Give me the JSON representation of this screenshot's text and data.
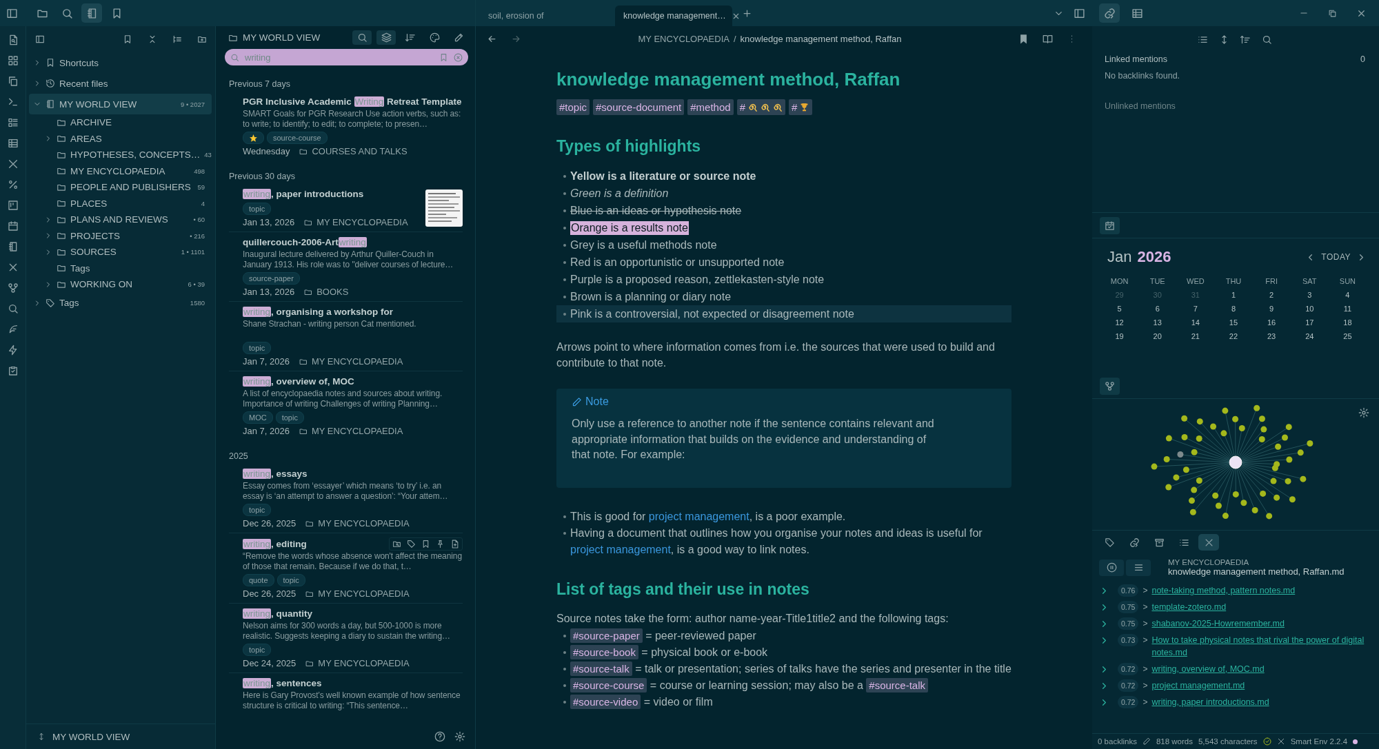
{
  "window": {
    "left_tabs": [
      {
        "selected": false
      },
      {
        "selected": false
      },
      {
        "selected": true
      },
      {
        "selected": false
      }
    ],
    "tabs": [
      {
        "label": "soil, erosion of",
        "selected": false
      },
      {
        "label": "knowledge management…",
        "selected": true
      }
    ],
    "right_tabs": [
      {
        "selected": true
      },
      {
        "selected": false
      }
    ]
  },
  "file_explorer": {
    "items": [
      {
        "label": "Shortcuts",
        "kind": "shortcuts",
        "expanded": false,
        "selected": false
      },
      {
        "label": "Recent files",
        "kind": "recent",
        "expanded": false,
        "selected": false
      },
      {
        "label": "MY WORLD VIEW",
        "kind": "vault",
        "expanded": true,
        "selected": true,
        "count": "9 • 2027",
        "children": [
          {
            "label": "ARCHIVE",
            "selected": false
          },
          {
            "label": "AREAS",
            "expanded": false,
            "selected": false
          },
          {
            "label": "HYPOTHESES, CONCEPTS…",
            "selected": false,
            "count": "43"
          },
          {
            "label": "MY ENCYCLOPAEDIA",
            "selected": false,
            "count": "498"
          },
          {
            "label": "PEOPLE AND PUBLISHERS",
            "selected": false,
            "count": "59"
          },
          {
            "label": "PLACES",
            "selected": false,
            "count": "4"
          },
          {
            "label": "PLANS AND REVIEWS",
            "expanded": false,
            "selected": false,
            "count": "• 60"
          },
          {
            "label": "PROJECTS",
            "expanded": false,
            "selected": false,
            "count": "• 216"
          },
          {
            "label": "SOURCES",
            "expanded": false,
            "selected": false,
            "count": "1 • 1101"
          },
          {
            "label": "Tags",
            "selected": false
          },
          {
            "label": "WORKING ON",
            "expanded": false,
            "selected": false,
            "count": "6 • 39"
          }
        ]
      },
      {
        "label": "Tags",
        "kind": "tags",
        "expanded": false,
        "selected": false,
        "count": "1580"
      }
    ],
    "footer": "MY WORLD VIEW"
  },
  "notes_pane": {
    "title": "MY WORLD VIEW",
    "toolbar": [
      {
        "selected": true
      },
      {
        "selected": true
      },
      {
        "selected": false
      },
      {
        "selected": false
      },
      {
        "selected": false
      }
    ],
    "search": "writing",
    "groups": [
      {
        "label": "Previous 7 days",
        "notes": [
          {
            "parts": [
              {
                "text": "PGR Inclusive Academic ",
                "kind": "text"
              },
              {
                "text": "Writing",
                "kind": "highlight"
              },
              {
                "text": " Retreat Template",
                "kind": "text"
              }
            ],
            "excerpt": "SMART Goals for PGR Research Use action verbs, such as: to write; to identify; to edit; to complete; to presen…",
            "tags": [
              {
                "kind": "star"
              },
              {
                "kind": "text",
                "label": "source-course"
              }
            ],
            "date": "Wednesday",
            "folder": "COURSES AND TALKS",
            "thumbnail": false,
            "hovered": false
          }
        ]
      },
      {
        "label": "Previous 30 days",
        "notes": [
          {
            "parts": [
              {
                "text": "writing",
                "kind": "highlight"
              },
              {
                "text": ", paper introductions",
                "kind": "text"
              }
            ],
            "tags": [
              {
                "kind": "text",
                "label": "topic"
              }
            ],
            "date": "Jan 13, 2026",
            "folder": "MY ENCYCLOPAEDIA",
            "thumbnail": true,
            "hovered": false
          },
          {
            "parts": [
              {
                "text": "quillercouch-2006-Art",
                "kind": "text"
              },
              {
                "text": "writing",
                "kind": "highlight"
              }
            ],
            "excerpt": "Inaugural lecture delivered by Arthur Quiller-Couch in January 1913. His role was to \"deliver courses of lecture…",
            "tags": [
              {
                "kind": "text",
                "label": "source-paper"
              }
            ],
            "date": "Jan 13, 2026",
            "folder": "BOOKS",
            "thumbnail": false,
            "hovered": false
          },
          {
            "parts": [
              {
                "text": "writing",
                "kind": "highlight"
              },
              {
                "text": ", organising a workshop for",
                "kind": "text"
              }
            ],
            "excerpt": "Shane Strachan - writing person Cat mentioned.",
            "tags": [
              {
                "kind": "text",
                "label": "topic"
              }
            ],
            "date": "Jan 7, 2026",
            "folder": "MY ENCYCLOPAEDIA",
            "thumbnail": false,
            "hovered": false
          },
          {
            "parts": [
              {
                "text": "writing",
                "kind": "highlight"
              },
              {
                "text": ", overview of, MOC",
                "kind": "text"
              }
            ],
            "excerpt": "A list of encyclopaedia notes and sources about writing. Importance of writing Challenges of writing Planning…",
            "tags": [
              {
                "kind": "text",
                "label": "MOC"
              },
              {
                "kind": "text",
                "label": "topic"
              }
            ],
            "date": "Jan 7, 2026",
            "folder": "MY ENCYCLOPAEDIA",
            "thumbnail": false,
            "hovered": false
          }
        ]
      },
      {
        "label": "2025",
        "notes": [
          {
            "parts": [
              {
                "text": "writing",
                "kind": "highlight"
              },
              {
                "text": ", essays",
                "kind": "text"
              }
            ],
            "excerpt": "Essay comes from ‘essayer’ which means ‘to try’ i.e. an essay is ‘an attempt to answer a question’: “Your attem…",
            "tags": [
              {
                "kind": "text",
                "label": "topic"
              }
            ],
            "date": "Dec 26, 2025",
            "folder": "MY ENCYCLOPAEDIA",
            "thumbnail": false,
            "hovered": false
          },
          {
            "parts": [
              {
                "text": "writing",
                "kind": "highlight"
              },
              {
                "text": ", editing",
                "kind": "text"
              }
            ],
            "excerpt": "“Remove the words whose absence won't affect the meaning of those that remain. Because if we do that, t…",
            "tags": [
              {
                "kind": "text",
                "label": "quote"
              },
              {
                "kind": "text",
                "label": "topic"
              }
            ],
            "date": "Dec 26, 2025",
            "folder": "MY ENCYCLOPAEDIA",
            "thumbnail": false,
            "hovered": true
          },
          {
            "parts": [
              {
                "text": "writing",
                "kind": "highlight"
              },
              {
                "text": ", quantity",
                "kind": "text"
              }
            ],
            "excerpt": "Nelson aims for 300 words a day, but 500-1000 is more realistic. Suggests keeping a diary to sustain the writing…",
            "tags": [
              {
                "kind": "text",
                "label": "topic"
              }
            ],
            "date": "Dec 24, 2025",
            "folder": "MY ENCYCLOPAEDIA",
            "thumbnail": false,
            "hovered": false
          },
          {
            "parts": [
              {
                "text": "writing",
                "kind": "highlight"
              },
              {
                "text": ", sentences",
                "kind": "text"
              }
            ],
            "excerpt": "Here is Gary Provost’s well known example of how sentence structure is critical to writing: “This sentence…",
            "thumbnail": false,
            "hovered": false
          }
        ]
      }
    ]
  },
  "editor": {
    "breadcrumb": {
      "folder": "MY ENCYCLOPAEDIA",
      "separator": "/",
      "note": "knowledge management method, Raffan"
    },
    "bookmarked": true,
    "title": "knowledge management method, Raffan",
    "tags": [
      {
        "label": "#topic",
        "kind": "text"
      },
      {
        "label": "#source-document",
        "kind": "text"
      },
      {
        "label": "#method",
        "kind": "text"
      },
      {
        "label": "#",
        "kind": "swirls"
      },
      {
        "label": "#",
        "kind": "trophy"
      }
    ],
    "blocks": [
      {
        "kind": "h2",
        "text": "Types of highlights"
      },
      {
        "kind": "styled_list",
        "items": [
          {
            "text": "Yellow is a literature or source note",
            "kind": "bold",
            "active": false
          },
          {
            "text": "Green is a definition",
            "kind": "italic",
            "active": false
          },
          {
            "text": "Blue is an ideas or hypothesis note",
            "kind": "strike",
            "active": false
          },
          {
            "text": "Orange is a results note",
            "kind": "highlight",
            "active": false
          },
          {
            "text": "Grey is a useful methods note",
            "kind": "plain",
            "active": false
          },
          {
            "text": "Red is an opportunistic or unsupported note",
            "kind": "plain",
            "active": false
          },
          {
            "text": "Purple is a proposed reason, zettlekasten-style note",
            "kind": "plain",
            "active": false
          },
          {
            "text": "Brown is a planning or diary note",
            "kind": "plain",
            "active": false
          },
          {
            "text": "Pink is a controversial, not expected or disagreement note",
            "kind": "plain",
            "active": true
          }
        ]
      },
      {
        "kind": "paragraph",
        "parts": [
          {
            "kind": "text",
            "text": "Arrows point to where information comes from i.e. the sources that were used to build and contribute to that note."
          }
        ]
      },
      {
        "kind": "callout",
        "title": "Note",
        "text": "Only use a reference to another note if the sentence contains relevant and appropriate information that builds on the evidence and understanding of that note. For example:"
      },
      {
        "kind": "list",
        "items": [
          {
            "parts": [
              {
                "kind": "text",
                "text": "This is good for "
              },
              {
                "kind": "link",
                "text": "project management"
              },
              {
                "kind": "text",
                "text": ", is a poor example."
              }
            ]
          },
          {
            "parts": [
              {
                "kind": "text",
                "text": "Having a document that outlines how you organise your notes and ideas is useful for "
              },
              {
                "kind": "link",
                "text": "project management"
              },
              {
                "kind": "text",
                "text": ", is a good way to link notes."
              }
            ]
          }
        ]
      },
      {
        "kind": "h2",
        "text": "List of tags and their use in notes"
      },
      {
        "kind": "lead",
        "parts": [
          {
            "kind": "text",
            "text": "Source notes take the form: author name-year-Title1title2 and the following tags:"
          }
        ]
      },
      {
        "kind": "list",
        "items": [
          {
            "parts": [
              {
                "kind": "tag",
                "text": "#source-paper"
              },
              {
                "kind": "text",
                "text": " = peer-reviewed paper"
              }
            ]
          },
          {
            "parts": [
              {
                "kind": "tag",
                "text": "#source-book"
              },
              {
                "kind": "text",
                "text": " = physical book or e-book"
              }
            ]
          },
          {
            "parts": [
              {
                "kind": "tag",
                "text": "#source-talk"
              },
              {
                "kind": "text",
                "text": " = talk or presentation; series of talks have the series and presenter in the title"
              }
            ]
          },
          {
            "parts": [
              {
                "kind": "tag",
                "text": "#source-course"
              },
              {
                "kind": "text",
                "text": " = course or learning session; may also be a "
              },
              {
                "kind": "tag",
                "text": "#source-talk"
              }
            ]
          },
          {
            "parts": [
              {
                "kind": "tag",
                "text": "#source-video"
              },
              {
                "kind": "text",
                "text": " = video or film"
              }
            ]
          }
        ]
      }
    ]
  },
  "backlinks": {
    "linked_label": "Linked mentions",
    "linked_count": "0",
    "empty_message": "No backlinks found.",
    "unlinked_label": "Unlinked mentions"
  },
  "calendar": {
    "month": "Jan",
    "year": "2026",
    "today_label": "TODAY",
    "weekdays": [
      "MON",
      "TUE",
      "WED",
      "THU",
      "FRI",
      "SAT",
      "SUN"
    ],
    "weeks": [
      [
        {
          "day": "29",
          "muted": true
        },
        {
          "day": "30",
          "muted": true
        },
        {
          "day": "31",
          "muted": true
        },
        {
          "day": "1",
          "muted": false
        },
        {
          "day": "2",
          "muted": false
        },
        {
          "day": "3",
          "muted": false
        },
        {
          "day": "4",
          "muted": false
        }
      ],
      [
        {
          "day": "5",
          "muted": false
        },
        {
          "day": "6",
          "muted": false
        },
        {
          "day": "7",
          "muted": false
        },
        {
          "day": "8",
          "muted": false
        },
        {
          "day": "9",
          "muted": false
        },
        {
          "day": "10",
          "muted": false
        },
        {
          "day": "11",
          "muted": false
        }
      ],
      [
        {
          "day": "12",
          "muted": false
        },
        {
          "day": "13",
          "muted": false
        },
        {
          "day": "14",
          "muted": false
        },
        {
          "day": "15",
          "muted": false
        },
        {
          "day": "16",
          "muted": false
        },
        {
          "day": "17",
          "muted": false
        },
        {
          "day": "18",
          "muted": false
        }
      ],
      [
        {
          "day": "19",
          "muted": false
        },
        {
          "day": "20",
          "muted": false
        },
        {
          "day": "21",
          "muted": false
        },
        {
          "day": "22",
          "muted": false
        },
        {
          "day": "23",
          "muted": false
        },
        {
          "day": "24",
          "muted": false
        },
        {
          "day": "25",
          "muted": false
        }
      ]
    ]
  },
  "panel_tabs": [
    {
      "selected": false
    },
    {
      "selected": false
    },
    {
      "selected": false
    },
    {
      "selected": false
    },
    {
      "selected": true
    }
  ],
  "smart_connections": {
    "folder": "MY ENCYCLOPAEDIA",
    "file": "knowledge management method, Raffan.md",
    "results": [
      {
        "score": "0.76",
        "marker": ">",
        "title": "note-taking method, pattern notes.md"
      },
      {
        "score": "0.75",
        "marker": ">",
        "title": "template-zotero.md"
      },
      {
        "score": "0.75",
        "marker": ">",
        "title": "shabanov-2025-Howremember.md"
      },
      {
        "score": "0.73",
        "marker": ">",
        "title": "How to take physical notes that rival the power of digital notes.md"
      },
      {
        "score": "0.72",
        "marker": ">",
        "title": "writing, overview of, MOC.md"
      },
      {
        "score": "0.72",
        "marker": ">",
        "title": "project management.md"
      },
      {
        "score": "0.72",
        "marker": ">",
        "title": "writing, paper introductions.md"
      }
    ]
  },
  "status_bar": {
    "backlinks": "0 backlinks",
    "words": "818 words",
    "characters": "5,543 characters",
    "plugin": "Smart Env 2.2.4"
  }
}
